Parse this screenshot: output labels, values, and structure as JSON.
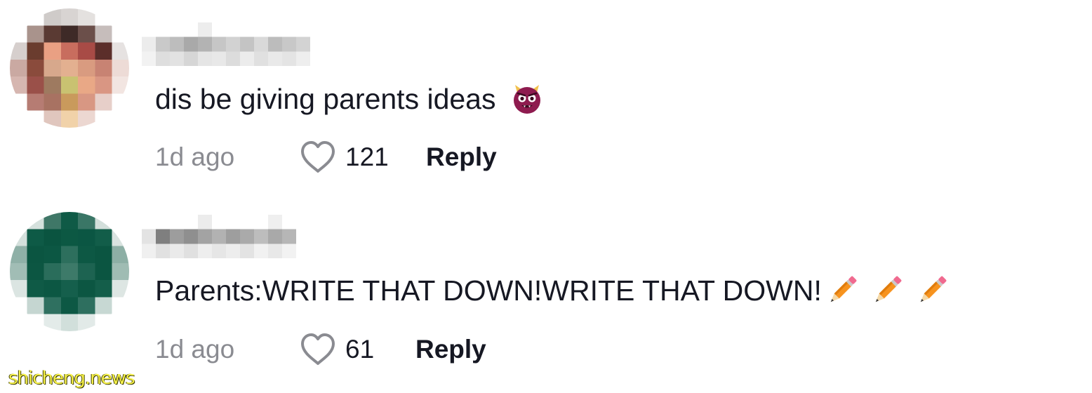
{
  "comments": [
    {
      "text": "dis be giving parents ideas",
      "emoji": "devil-icon",
      "time": "1d ago",
      "likes": "121",
      "reply_label": "Reply"
    },
    {
      "text": "Parents:WRITE THAT DOWN!WRITE THAT DOWN!",
      "emoji": "pencil-icon",
      "time": "1d ago",
      "likes": "61",
      "reply_label": "Reply"
    }
  ],
  "watermark": "shicheng.news",
  "colors": {
    "text": "#161823",
    "muted": "#8a8b91",
    "watermark": "#f7f24a"
  }
}
